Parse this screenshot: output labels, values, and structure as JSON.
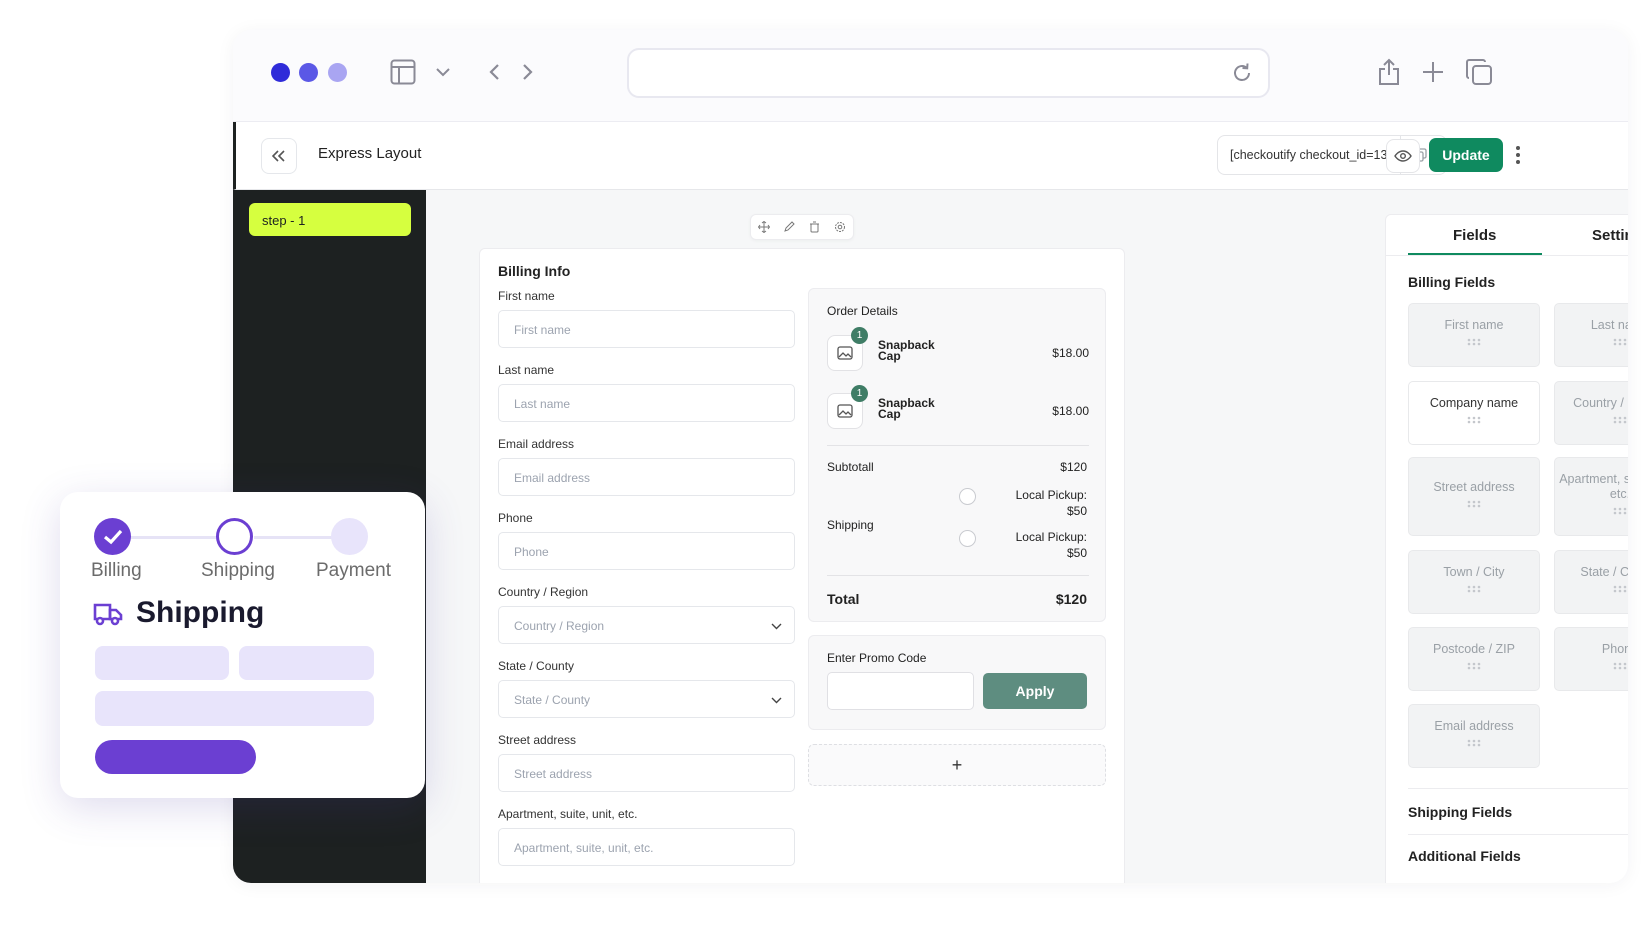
{
  "window": {
    "dots": [
      "#2f2bd9",
      "#5b58e6",
      "#a9a5f2"
    ],
    "url": ""
  },
  "topbar": {
    "title": "Express Layout",
    "shortcode": "[checkoutify checkout_id=13",
    "update_label": "Update"
  },
  "sidebar": {
    "step_label": "step - 1"
  },
  "billing": {
    "title": "Billing Info",
    "fields": [
      {
        "label": "First name",
        "placeholder": "First name"
      },
      {
        "label": "Last name",
        "placeholder": "Last name"
      },
      {
        "label": "Email address",
        "placeholder": "Email address"
      },
      {
        "label": "Phone",
        "placeholder": "Phone"
      },
      {
        "label": "Country / Region",
        "placeholder": "Country / Region"
      },
      {
        "label": "State / County",
        "placeholder": "State / County"
      },
      {
        "label": "Street address",
        "placeholder": "Street address"
      },
      {
        "label": "Apartment, suite, unit, etc.",
        "placeholder": "Apartment, suite, unit, etc."
      }
    ]
  },
  "order": {
    "title": "Order Details",
    "items": [
      {
        "name": "Snapback Cap",
        "qty": "1",
        "price": "$18.00"
      },
      {
        "name": "Snapback Cap",
        "qty": "1",
        "price": "$18.00"
      }
    ],
    "subtotal_label": "Subtotall",
    "subtotal_value": "$120",
    "shipping_label": "Shipping",
    "shipping_options": [
      "Local Pickup: $50",
      "Local Pickup: $50"
    ],
    "total_label": "Total",
    "total_value": "$120"
  },
  "promo": {
    "label": "Enter Promo Code",
    "value": "",
    "apply_label": "Apply",
    "add_symbol": "+"
  },
  "panel": {
    "tabs": [
      "Fields",
      "Settings"
    ],
    "active_tab": "Fields",
    "billing_group_title": "Billing Fields",
    "billing_fields": [
      "First name",
      "Last name",
      "Company name",
      "Country / Region",
      "Street address",
      "Apartment, suite, unit, etc.",
      "Town / City",
      "State / County",
      "Postcode / ZIP",
      "Phone",
      "Email address"
    ],
    "shipping_group_title": "Shipping Fields",
    "next_group_title": "Additional Fields"
  },
  "float_card": {
    "steps": [
      "Billing",
      "Shipping",
      "Payment"
    ],
    "title": "Shipping",
    "accent": "#6b3fd2"
  },
  "colors": {
    "update": "#0f8a5f",
    "step_pill": "#d6ff3f",
    "sidebar": "#1d2121",
    "apply": "#5e8d80"
  }
}
